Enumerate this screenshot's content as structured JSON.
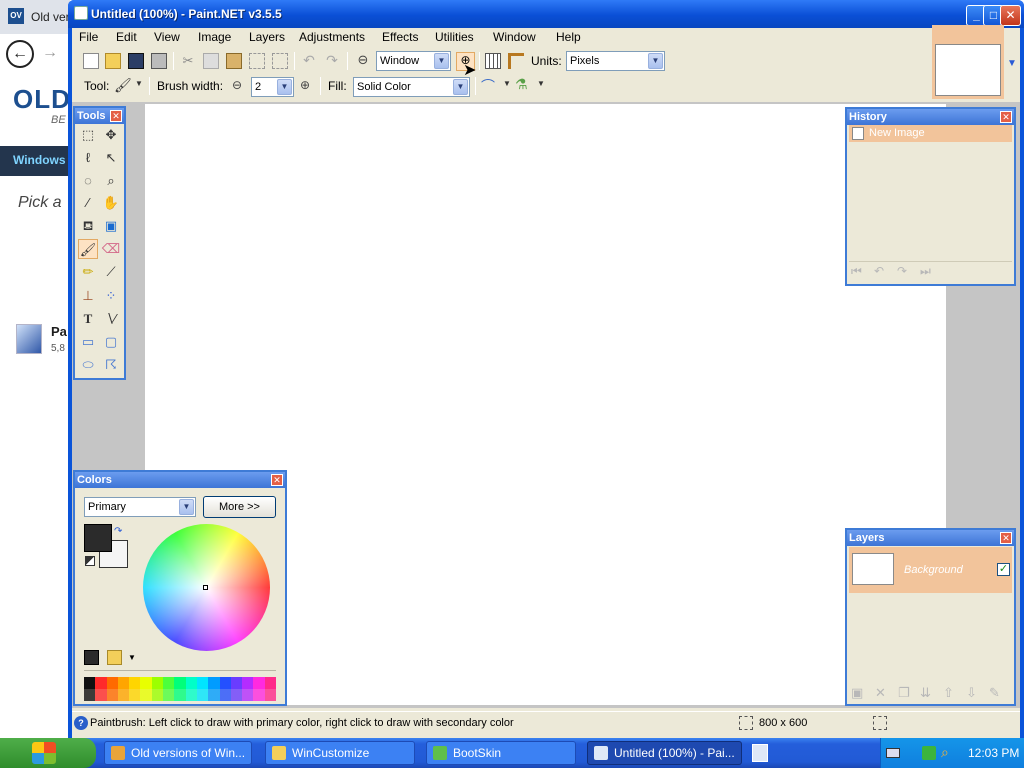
{
  "window": {
    "title": "Untitled (100%) - Paint.NET v3.5.5",
    "controls": {
      "minimize": "_",
      "maximize": "□",
      "close": "✕"
    }
  },
  "menu": [
    "File",
    "Edit",
    "View",
    "Image",
    "Layers",
    "Adjustments",
    "Effects",
    "Utilities",
    "Window",
    "Help"
  ],
  "toolbar": {
    "zoom_value": "Window",
    "units_label": "Units:",
    "units_value": "Pixels"
  },
  "tool_bar": {
    "tool_label": "Tool:",
    "brush_width_label": "Brush width:",
    "brush_width_value": "2",
    "fill_label": "Fill:",
    "fill_value": "Solid Color"
  },
  "tools_panel": {
    "title": "Tools",
    "tools": [
      "rectangle-select",
      "move-selected",
      "lasso-select",
      "move-selection",
      "ellipse-select",
      "zoom",
      "magic-wand",
      "pan",
      "paint-bucket",
      "gradient",
      "paintbrush",
      "eraser",
      "pencil",
      "color-picker",
      "clone-stamp",
      "recolor",
      "text",
      "line-curve",
      "rectangle",
      "rounded-rectangle",
      "ellipse",
      "freeform-shape"
    ],
    "selected": "paintbrush"
  },
  "history_panel": {
    "title": "History",
    "items": [
      "New Image"
    ]
  },
  "layers_panel": {
    "title": "Layers",
    "layers": [
      {
        "name": "Background",
        "visible": true
      }
    ]
  },
  "colors_panel": {
    "title": "Colors",
    "mode": "Primary",
    "more_button": "More >>",
    "primary_color": "#2b2b2b",
    "secondary_color": "#f5f5f5",
    "palette": [
      "#111111",
      "#ff2a2a",
      "#ff6a00",
      "#ffa500",
      "#ffd500",
      "#e8ff00",
      "#9cff00",
      "#4cff3c",
      "#00ff7a",
      "#00ffc8",
      "#00e5ff",
      "#009cff",
      "#2450ff",
      "#6a3cff",
      "#b42cff",
      "#ff2ae0",
      "#ff2a8a"
    ]
  },
  "statusbar": {
    "message": "Paintbrush: Left click to draw with primary color, right click to draw with secondary color",
    "image_size": "800 x 600"
  },
  "background_browser": {
    "tab_title": "Old vers",
    "favicon": "OV",
    "logo": "OLD",
    "logo_sub": "BE",
    "nav_item": "Windows",
    "heading": "Pick a",
    "app_title": "Pa",
    "app_size": "5,8"
  },
  "taskbar": {
    "tasks": [
      {
        "label": "Old versions of Win...",
        "active": false
      },
      {
        "label": "WinCustomize",
        "active": false
      },
      {
        "label": "BootSkin",
        "active": false
      },
      {
        "label": "Untitled (100%) - Pai...",
        "active": true
      }
    ],
    "clock": "12:03 PM"
  },
  "colors": {
    "xp_title_blue": "#0a54d9",
    "selection_orange": "#f2c49b",
    "panel_bg": "#ece9d8"
  }
}
